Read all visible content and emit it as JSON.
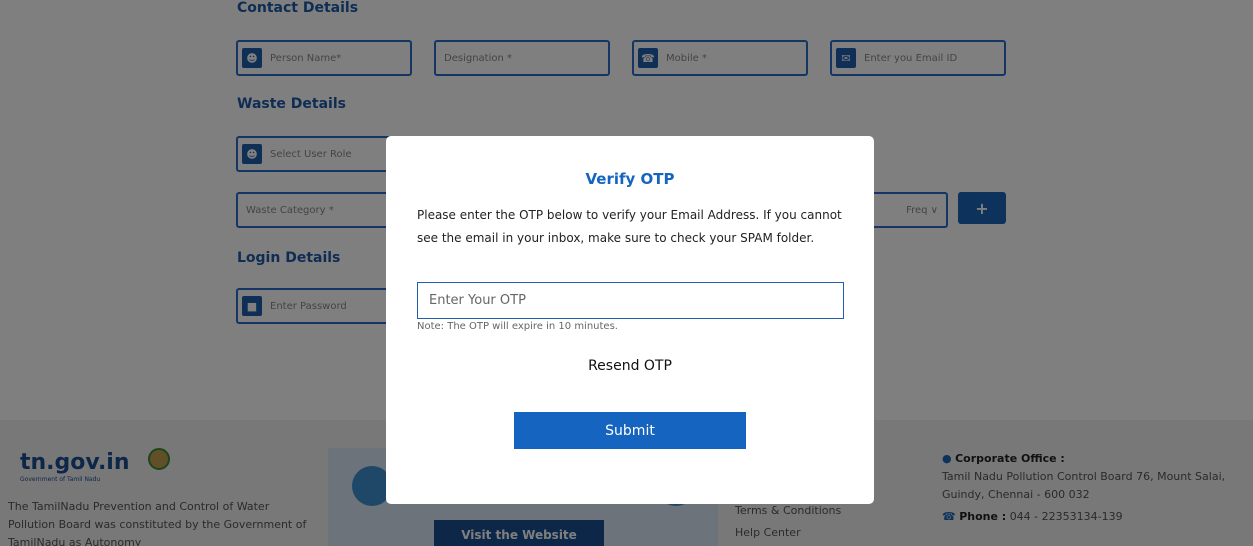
{
  "background": {
    "sections": {
      "contact": "Contact Details",
      "waste": "Waste Details",
      "login": "Login Details"
    },
    "fields": {
      "person_name": "Person Name*",
      "designation": "Designation *",
      "mobile": "Mobile *",
      "email": "Enter you Email ID",
      "user_role": "Select User Role",
      "waste_category": "Waste Category *",
      "frequency": "Freq ∨",
      "password": "Enter Password"
    },
    "plus_label": "+",
    "footer": {
      "logo": "tn.gov.in",
      "logo_sub": "Government of Tamil Nadu",
      "about": "The TamilNadu Prevention and Control of Water Pollution Board was constituted by the Government of TamilNadu as Autonomy",
      "visit_button": "Visit the Website",
      "links": [
        "Terms & Conditions",
        "Help Center"
      ],
      "office_title": "Corporate Office :",
      "office_address": "Tamil Nadu Pollution Control Board 76, Mount Salai, Guindy, Chennai - 600 032",
      "phone_label": "Phone :",
      "phone_value": "044 - 22353134-139"
    }
  },
  "modal": {
    "title": "Verify OTP",
    "description": "Please enter the OTP below to verify your Email Address. If you cannot see the email in your inbox, make sure to check your SPAM folder.",
    "otp_placeholder": "Enter Your OTP",
    "otp_value": "",
    "note": "Note: The OTP will expire in 10 minutes.",
    "resend_label": "Resend OTP",
    "submit_label": "Submit"
  }
}
